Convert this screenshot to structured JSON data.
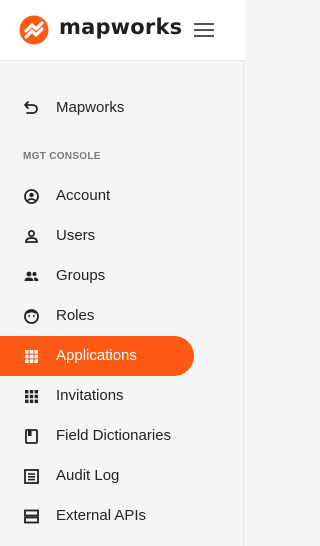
{
  "brand": {
    "name": "mapworks",
    "accent": "#ff5a14"
  },
  "back_link": {
    "label": "Mapworks",
    "icon": "back-arrow-icon"
  },
  "section": {
    "label": "MGT CONSOLE"
  },
  "nav": {
    "items": [
      {
        "label": "Account",
        "icon": "account-circle-icon"
      },
      {
        "label": "Users",
        "icon": "user-icon"
      },
      {
        "label": "Groups",
        "icon": "group-icon"
      },
      {
        "label": "Roles",
        "icon": "roles-face-icon"
      },
      {
        "label": "Applications",
        "icon": "grid-icon",
        "active": true
      },
      {
        "label": "Invitations",
        "icon": "dot-grid-icon"
      },
      {
        "label": "Field Dictionaries",
        "icon": "book-icon"
      },
      {
        "label": "Audit Log",
        "icon": "list-icon"
      },
      {
        "label": "External APIs",
        "icon": "server-icon"
      }
    ]
  }
}
